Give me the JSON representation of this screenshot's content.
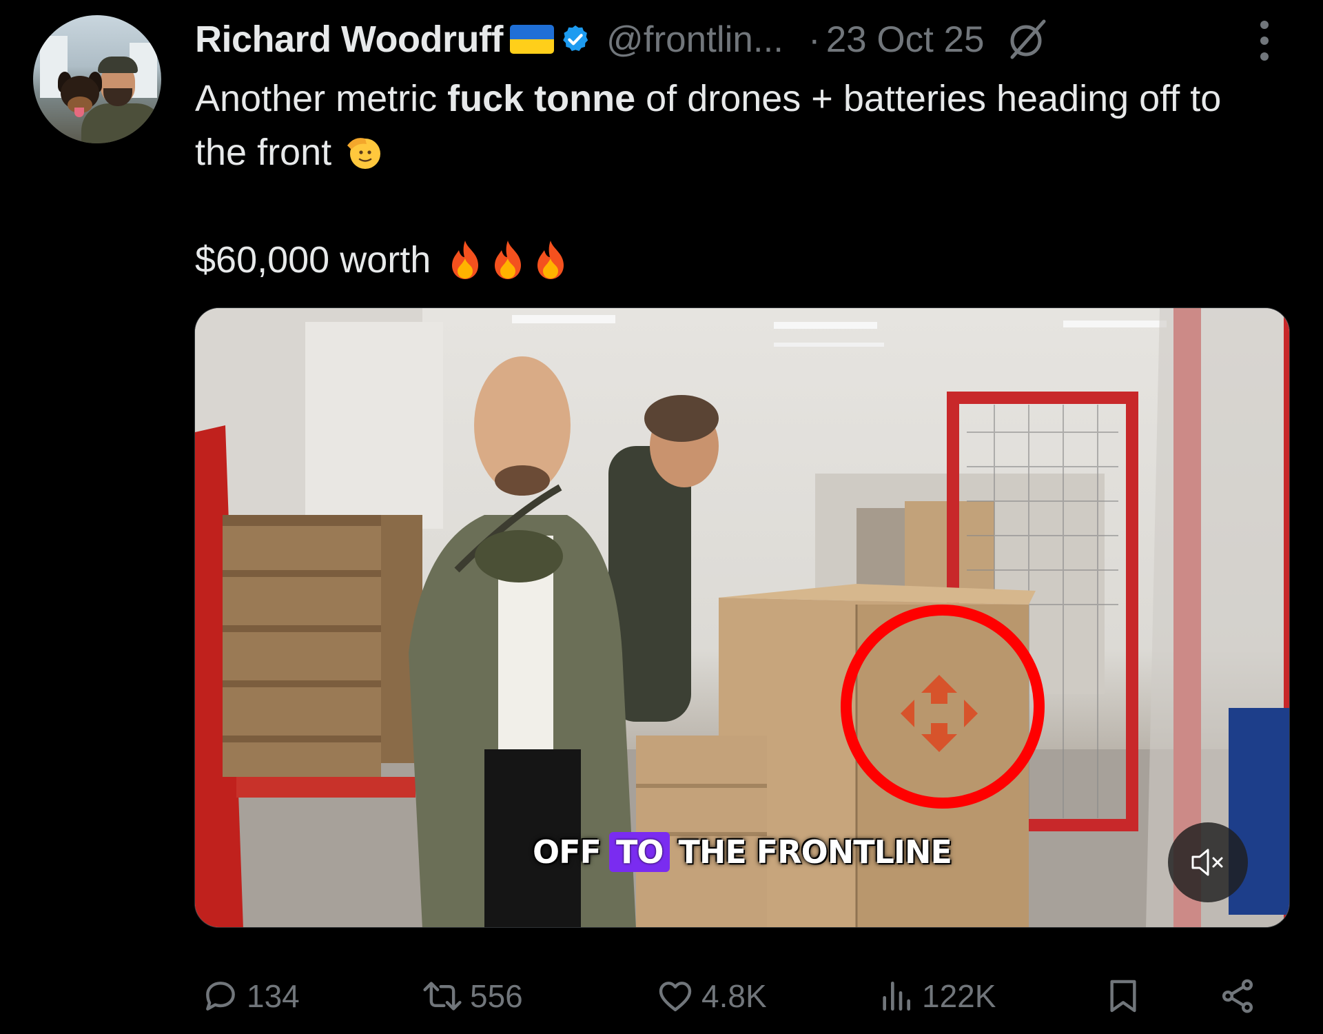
{
  "author": {
    "name": "Richard Woodruff",
    "handle": "@frontlin...",
    "date": "23 Oct 25",
    "dot": "·",
    "verified": true,
    "flag": "ukraine-flag"
  },
  "tweet": {
    "text_before": "Another metric ",
    "text_bold": "fuck tonne",
    "text_after": " of drones + batteries heading off to the front",
    "price_line": "$60,000 worth",
    "emoji_salute": "saluting-face",
    "emoji_fire_count": 3
  },
  "video": {
    "caption_1": "OFF",
    "caption_highlight": "TO",
    "caption_2": "THE FRONTLINE",
    "muted": true,
    "annotation": "red-circle"
  },
  "actions": {
    "replies": "134",
    "reposts": "556",
    "likes": "4.8K",
    "views": "122K"
  },
  "colors": {
    "background": "#000000",
    "text": "#e7e9ea",
    "muted_text": "#71767b",
    "verified": "#1d9bf0",
    "caption_highlight": "#7a2cf0",
    "annotation": "#ff0000"
  }
}
